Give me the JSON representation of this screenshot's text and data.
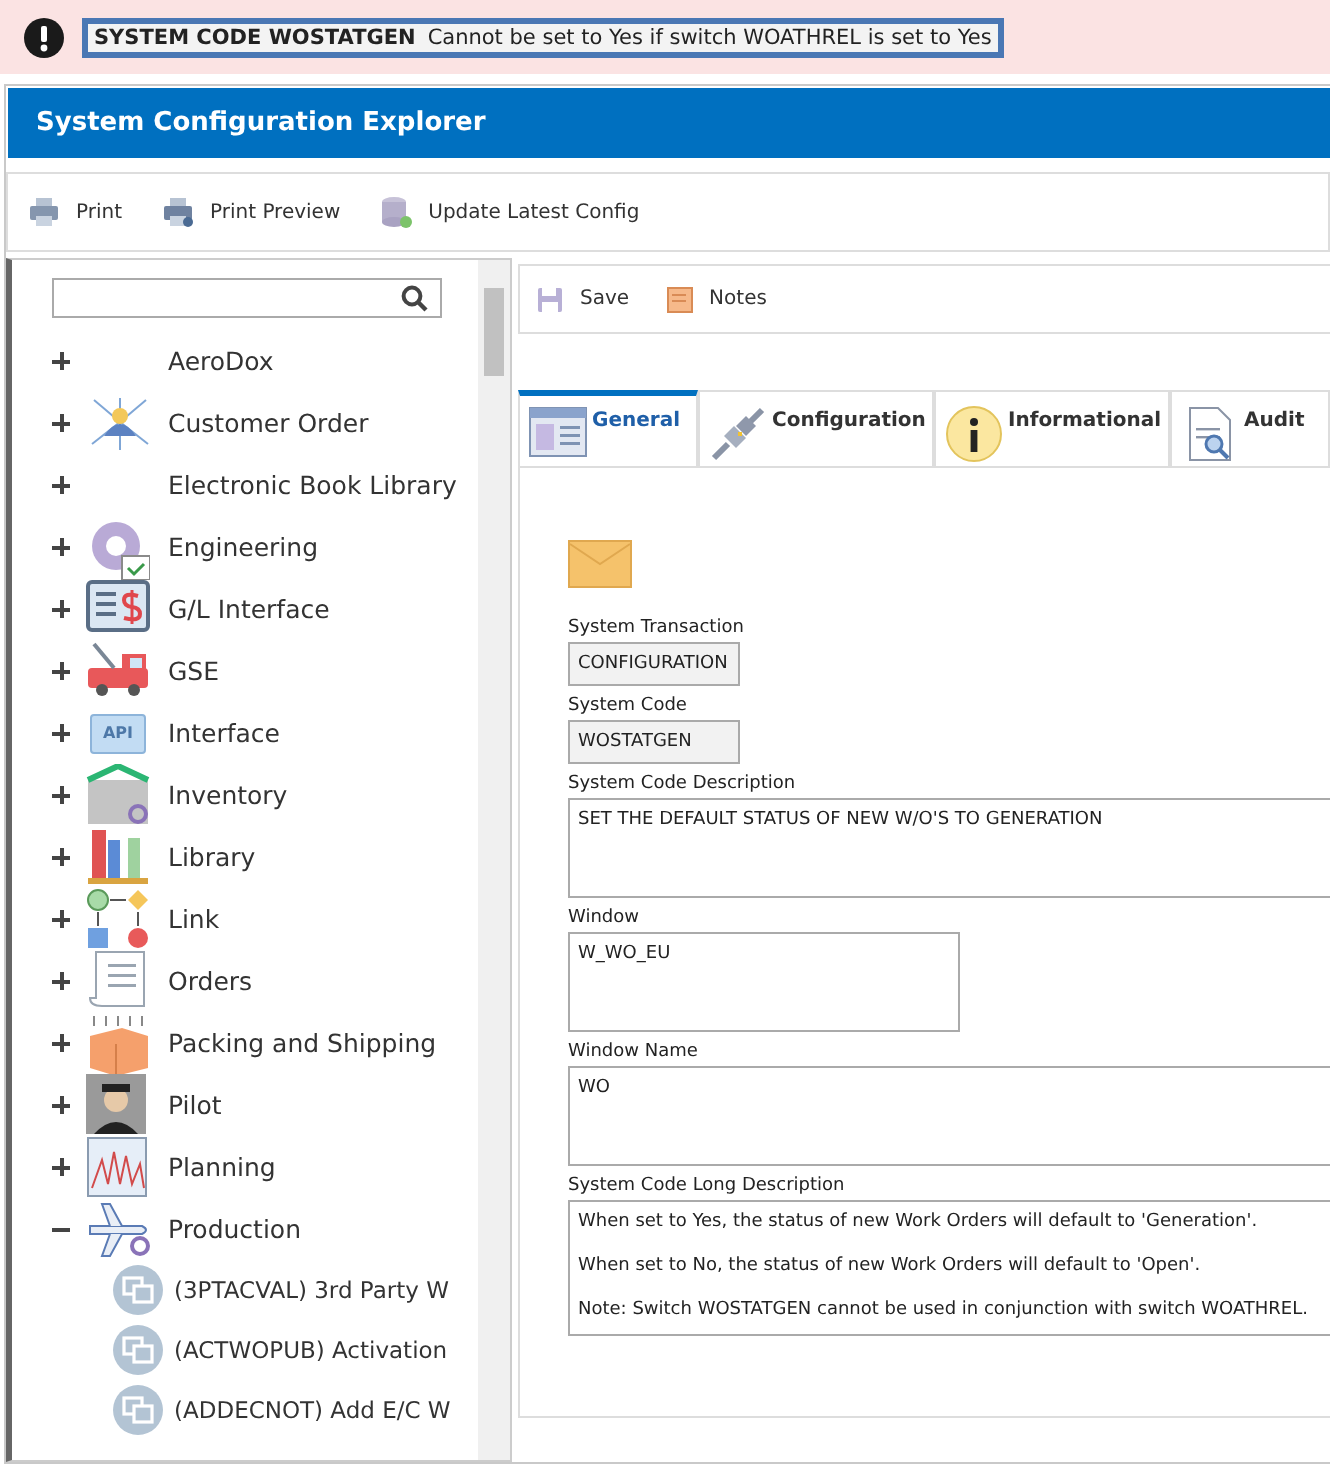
{
  "alert": {
    "code": "SYSTEM CODE WOSTATGEN",
    "message": "Cannot be set to Yes if switch WOATHREL is set to Yes"
  },
  "window": {
    "title": "System Configuration Explorer"
  },
  "toolbar": [
    "Print",
    "Print Preview",
    "Update Latest Config"
  ],
  "sidebar": {
    "items": [
      {
        "label": "AeroDox",
        "expanded": false
      },
      {
        "label": "Customer Order",
        "expanded": false
      },
      {
        "label": "Electronic Book Library",
        "expanded": false
      },
      {
        "label": "Engineering",
        "expanded": false
      },
      {
        "label": "G/L Interface",
        "expanded": false
      },
      {
        "label": "GSE",
        "expanded": false
      },
      {
        "label": "Interface",
        "expanded": false,
        "icon_text": "API"
      },
      {
        "label": "Inventory",
        "expanded": false
      },
      {
        "label": "Library",
        "expanded": false
      },
      {
        "label": "Link",
        "expanded": false
      },
      {
        "label": "Orders",
        "expanded": false
      },
      {
        "label": "Packing and Shipping",
        "expanded": false
      },
      {
        "label": "Pilot",
        "expanded": false
      },
      {
        "label": "Planning",
        "expanded": false
      },
      {
        "label": "Production",
        "expanded": true,
        "children": [
          {
            "label": "(3PTACVAL) 3rd Party W"
          },
          {
            "label": "(ACTWOPUB) Activation"
          },
          {
            "label": "(ADDECNOT) Add E/C W"
          }
        ]
      }
    ]
  },
  "detail_toolbar": [
    "Save",
    "Notes"
  ],
  "tabs": [
    {
      "label": "General",
      "selected": true
    },
    {
      "label": "Configuration",
      "selected": false
    },
    {
      "label": "Informational",
      "selected": false
    },
    {
      "label": "Audit",
      "selected": false
    }
  ],
  "fields": [
    {
      "kind": "readonly",
      "label": "System Transaction",
      "value": "CONFIGURATION"
    },
    {
      "kind": "readonly",
      "label": "System Code",
      "value": "WOSTATGEN"
    },
    {
      "kind": "memo",
      "label": "System Code Description",
      "value": "SET THE DEFAULT STATUS OF NEW W/O'S TO GENERATION"
    },
    {
      "kind": "half",
      "label": "Window",
      "value": "W_WO_EU"
    },
    {
      "kind": "memo",
      "label": "Window Name",
      "value": "WO"
    },
    {
      "kind": "note",
      "label": "System Code Long Description",
      "paragraphs": [
        "When set to Yes, the status of new Work Orders will default to 'Generation'.",
        "When set to No, the status of new Work Orders will default to 'Open'.",
        "Note: Switch WOSTATGEN cannot be used in conjunction with switch WOATHREL."
      ]
    }
  ]
}
